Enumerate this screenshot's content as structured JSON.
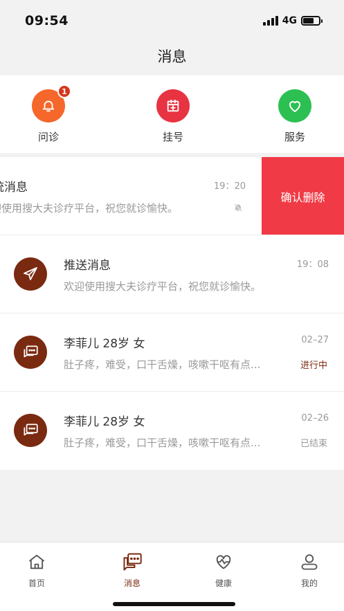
{
  "status_bar": {
    "time": "09:54",
    "network": "4G"
  },
  "header": {
    "title": "消息"
  },
  "quick_actions": [
    {
      "label": "问诊",
      "icon": "bell-icon",
      "color": "#f5672a",
      "badge": "1"
    },
    {
      "label": "挂号",
      "icon": "calendar-plus-icon",
      "color": "#e83342"
    },
    {
      "label": "服务",
      "icon": "heart-icon",
      "color": "#2cc052"
    }
  ],
  "messages": [
    {
      "title": "系统消息",
      "subtitle": "欢迎使用搜大夫诊疗平台，祝您就诊愉快。",
      "time": "19：20",
      "icon": "mute-bell-icon",
      "swiped": true,
      "action": "确认删除"
    },
    {
      "title": "推送消息",
      "subtitle": "欢迎使用搜大夫诊疗平台，祝您就诊愉快。",
      "time": "19：08",
      "icon": "paper-plane-icon"
    },
    {
      "title": "李菲儿  28岁  女",
      "subtitle": "肚子疼，难受，口干舌燥，咳嗽干呕有点...",
      "time": "02–27",
      "status": "进行中",
      "status_color": "#7a2a10",
      "icon": "chat-bubble-icon"
    },
    {
      "title": "李菲儿  28岁  女",
      "subtitle": "肚子疼，难受，口干舌燥，咳嗽干呕有点...",
      "time": "02–26",
      "status": "已结束",
      "status_color": "#999999",
      "icon": "chat-bubble-icon"
    }
  ],
  "tabbar": [
    {
      "label": "首页",
      "icon": "home-icon"
    },
    {
      "label": "消息",
      "icon": "messages-icon",
      "active": true
    },
    {
      "label": "健康",
      "icon": "health-heart-icon"
    },
    {
      "label": "我的",
      "icon": "user-icon"
    }
  ],
  "colors": {
    "accent": "#7a2a10",
    "delete": "#f03a45"
  }
}
